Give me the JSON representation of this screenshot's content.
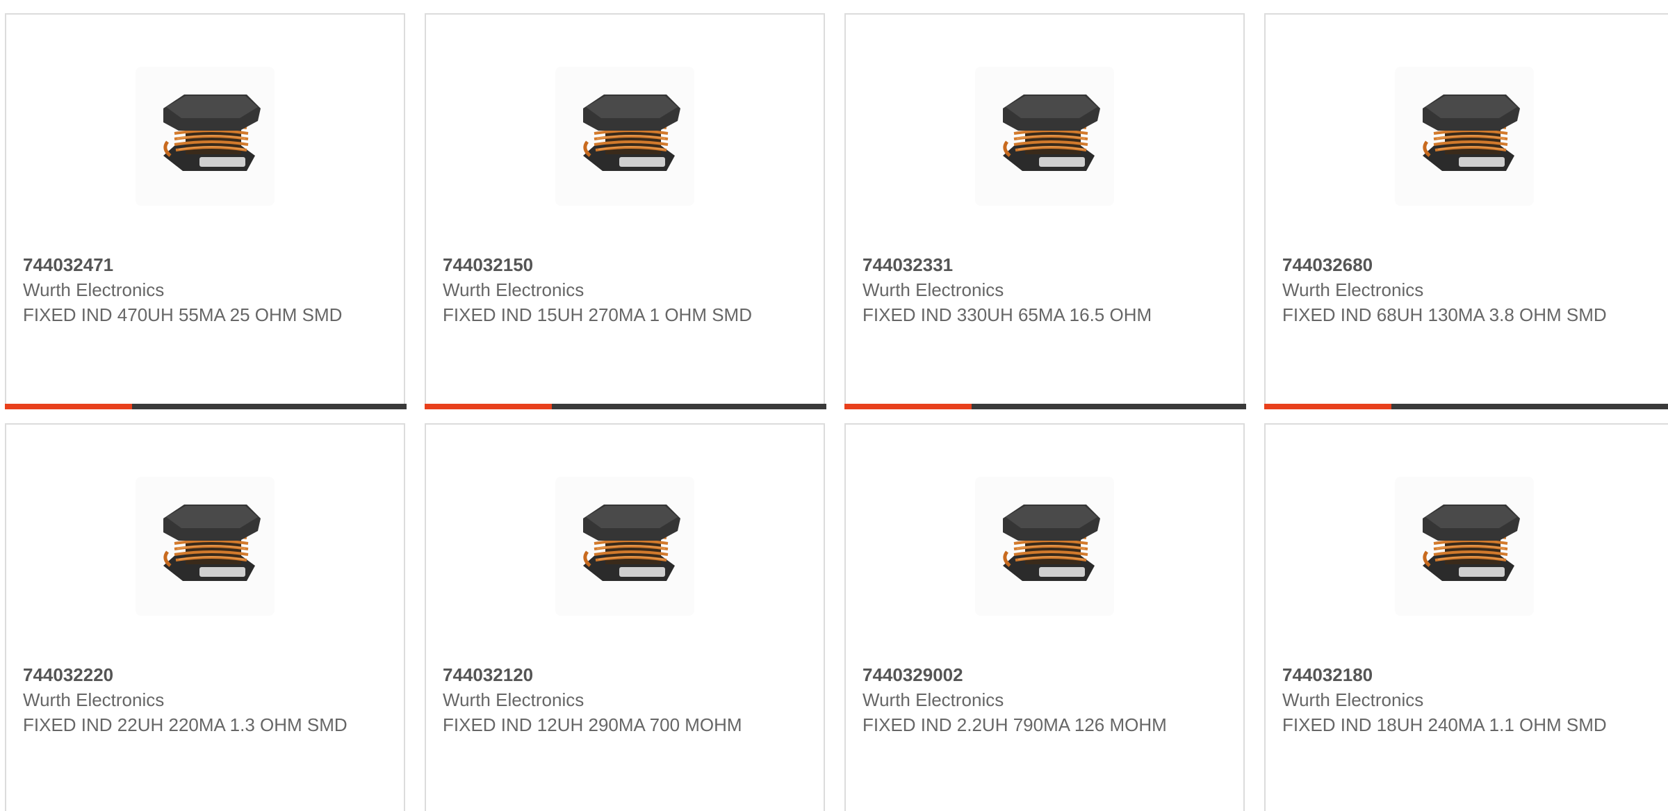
{
  "products": [
    {
      "part_number": "744032471",
      "manufacturer": "Wurth Electronics",
      "description": "FIXED IND 470UH 55MA 25 OHM SMD",
      "image_icon": "smd-inductor-icon"
    },
    {
      "part_number": "744032150",
      "manufacturer": "Wurth Electronics",
      "description": "FIXED IND 15UH 270MA 1 OHM SMD",
      "image_icon": "smd-inductor-icon"
    },
    {
      "part_number": "744032331",
      "manufacturer": "Wurth Electronics",
      "description": "FIXED IND 330UH 65MA 16.5 OHM",
      "image_icon": "smd-inductor-icon"
    },
    {
      "part_number": "744032680",
      "manufacturer": "Wurth Electronics",
      "description": "FIXED IND 68UH 130MA 3.8 OHM SMD",
      "image_icon": "smd-inductor-icon"
    },
    {
      "part_number": "744032220",
      "manufacturer": "Wurth Electronics",
      "description": "FIXED IND 22UH 220MA 1.3 OHM SMD",
      "image_icon": "smd-inductor-icon"
    },
    {
      "part_number": "744032120",
      "manufacturer": "Wurth Electronics",
      "description": "FIXED IND 12UH 290MA 700 MOHM",
      "image_icon": "smd-inductor-icon"
    },
    {
      "part_number": "7440329002",
      "manufacturer": "Wurth Electronics",
      "description": "FIXED IND 2.2UH 790MA 126 MOHM",
      "image_icon": "smd-inductor-icon"
    },
    {
      "part_number": "744032180",
      "manufacturer": "Wurth Electronics",
      "description": "FIXED IND 18UH 240MA 1.1 OHM SMD",
      "image_icon": "smd-inductor-icon"
    }
  ],
  "colors": {
    "accent": "#e8401c",
    "bar": "#3a3a3a",
    "text": "#666666",
    "border": "#dcdcdc"
  }
}
